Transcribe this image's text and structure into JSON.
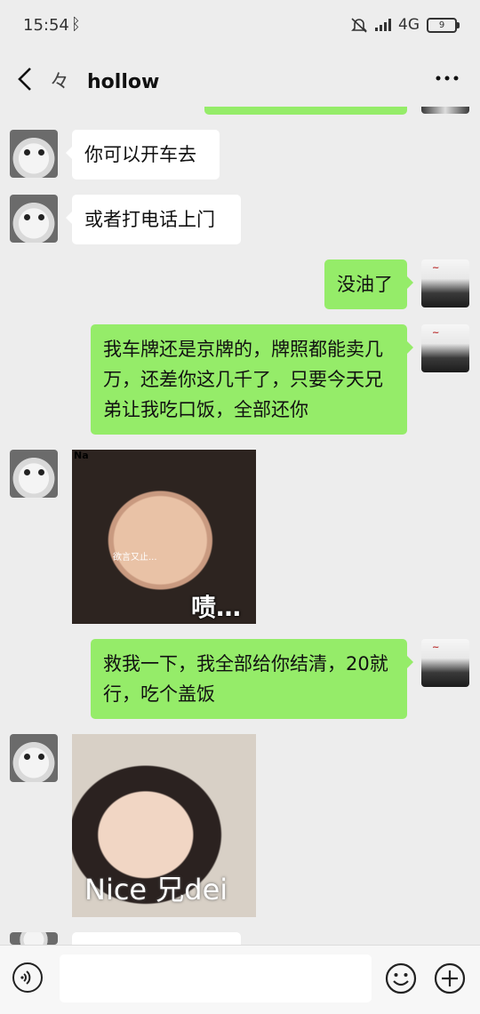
{
  "status_bar": {
    "time": "15:54",
    "bluetooth_icon": "bluetooth-icon",
    "network": "4G",
    "battery": "9"
  },
  "header": {
    "symbol": "々",
    "title": "hollow"
  },
  "messages": [
    {
      "side": "left",
      "type": "text",
      "text": "你可以开车去"
    },
    {
      "side": "left",
      "type": "text",
      "text": "或者打电话上门"
    },
    {
      "side": "right",
      "type": "text",
      "text": "没油了"
    },
    {
      "side": "right",
      "type": "text",
      "text": "我车牌还是京牌的，牌照都能卖几万，还差你这几千了，只要今天兄弟让我吃口饭，全部还你"
    },
    {
      "side": "left",
      "type": "sticker",
      "corner_text": "Na",
      "caption_small": "欲言又止...",
      "caption_big": "啧…"
    },
    {
      "side": "right",
      "type": "text",
      "text": "救我一下，我全部给你结清，20就行，吃个盖饭"
    },
    {
      "side": "left",
      "type": "sticker",
      "caption": "Nice 兄dei"
    }
  ],
  "input": {
    "placeholder": ""
  },
  "colors": {
    "background": "#ededed",
    "bubble_self": "#95ec69",
    "bubble_other": "#ffffff"
  }
}
